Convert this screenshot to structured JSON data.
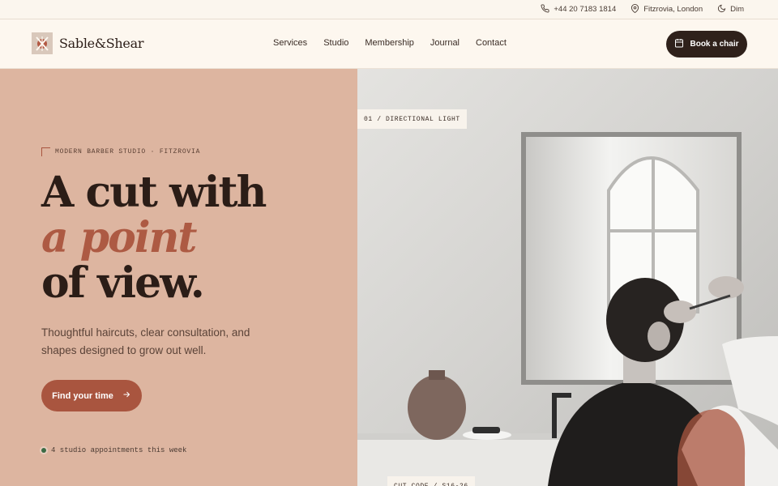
{
  "topbar": {
    "phone": "+44 20 7183 1814",
    "location": "Fitzrovia, London",
    "theme_toggle": "Dim"
  },
  "header": {
    "brand": "Sable&Shear",
    "nav": [
      "Services",
      "Studio",
      "Membership",
      "Journal",
      "Contact"
    ],
    "cta": "Book a chair"
  },
  "hero": {
    "kicker": "MODERN BARBER STUDIO · FITZROVIA",
    "headline_line1": "A cut with",
    "headline_line2": "a point",
    "headline_line3": "of view.",
    "lead": "Thoughtful haircuts, clear consultation, and shapes designed to grow out well.",
    "cta": "Find your time",
    "status": "4 studio appointments this week",
    "image_tag_top": "01 / DIRECTIONAL LIGHT",
    "image_tag_bottom": "CUT CODE / S16-26"
  },
  "colors": {
    "accent": "#a9553f",
    "dark": "#2f211b",
    "hero_bg": "#ddb5a0",
    "page_bg": "#fbf6ee",
    "status_dot": "#3c6b45"
  },
  "icons": [
    "phone-icon",
    "map-pin-icon",
    "moon-icon",
    "calendar-icon",
    "arrow-right-icon",
    "logo-mark-icon"
  ]
}
